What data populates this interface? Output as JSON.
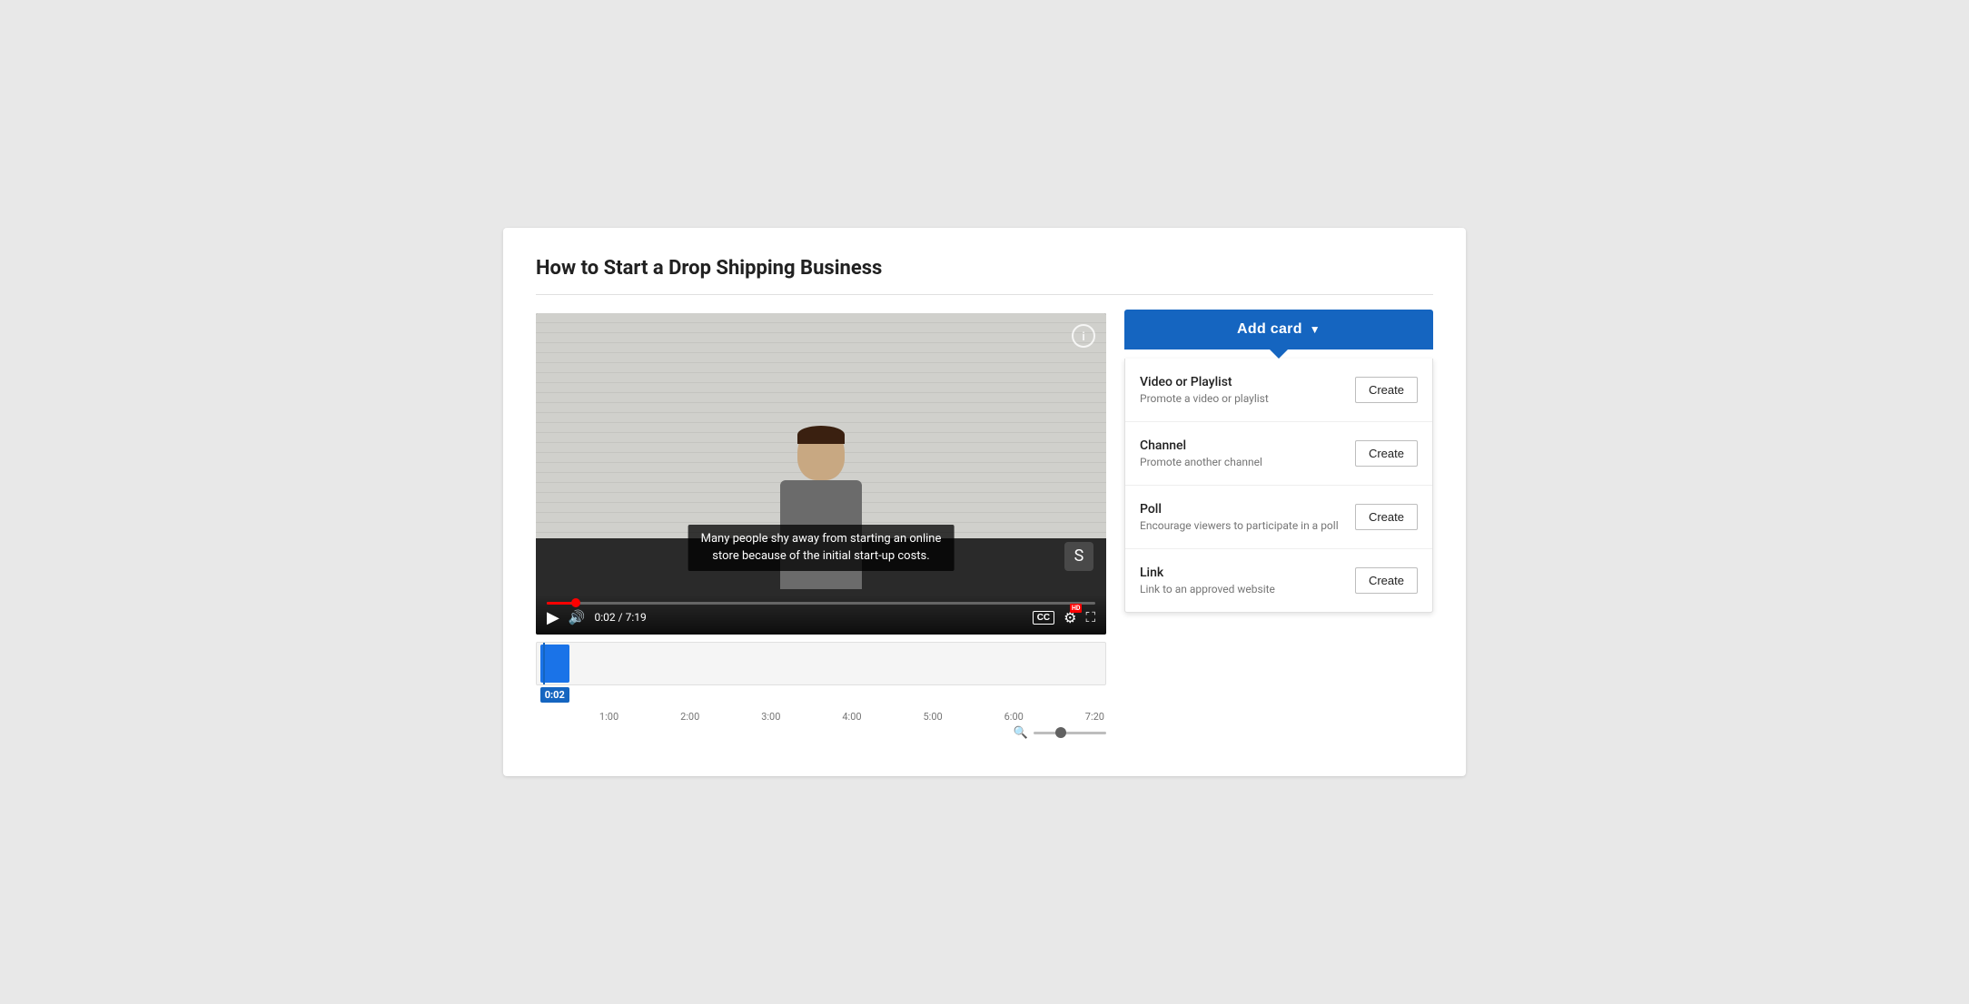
{
  "page": {
    "title": "How to Start a Drop Shipping Business"
  },
  "video": {
    "caption_line1": "Many people shy away from starting an online",
    "caption_line2": "store because of the initial start-up costs.",
    "time_current": "0:02",
    "time_total": "7:19",
    "progress_percent": 4.5
  },
  "add_card": {
    "button_label": "Add card",
    "dropdown_arrow": "▼",
    "options": [
      {
        "id": "video-playlist",
        "title": "Video or Playlist",
        "description": "Promote a video or playlist",
        "button_label": "Create"
      },
      {
        "id": "channel",
        "title": "Channel",
        "description": "Promote another channel",
        "button_label": "Create"
      },
      {
        "id": "poll",
        "title": "Poll",
        "description": "Encourage viewers to participate in a poll",
        "button_label": "Create"
      },
      {
        "id": "link",
        "title": "Link",
        "description": "Link to an approved website",
        "button_label": "Create"
      }
    ]
  },
  "timeline": {
    "labels": [
      "0:02",
      "1:00",
      "2:00",
      "3:00",
      "4:00",
      "5:00",
      "6:00",
      "7:20"
    ],
    "current_label": "0:02"
  }
}
